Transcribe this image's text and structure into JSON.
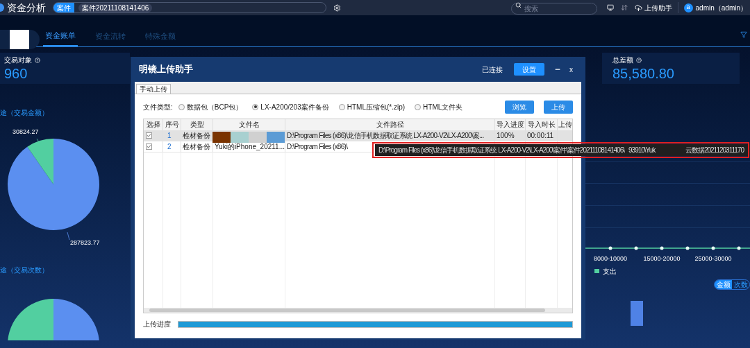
{
  "app": {
    "title": "资金分析",
    "case_tag": "案件",
    "case_chip": "案件20211108141406",
    "search": {
      "placeholder": "搜索"
    },
    "upload_helper": "上传助手",
    "avatar": "a",
    "user": "admin（admin）"
  },
  "tabs": [
    {
      "label": "资金账单",
      "selected": true
    },
    {
      "label": "资金流转",
      "selected": false
    },
    {
      "label": "特殊金额",
      "selected": false
    }
  ],
  "left": {
    "card": {
      "label": "交易对象",
      "value": "960"
    },
    "amount_title": "途（交易金额）",
    "chart_data": {
      "type": "pie",
      "values": [
        287823.77,
        30824.27
      ],
      "colors": [
        "#5b8ff0",
        "#52cfa0"
      ],
      "data_labels": true
    },
    "count_title": "途（交易次数）"
  },
  "right": {
    "card": {
      "label": "总差额",
      "value": "85,580.80"
    },
    "range_labels": [
      "8000-10000",
      "15000-20000",
      "25000-30000"
    ],
    "legend": {
      "label": "支出",
      "color": "#52cfa0"
    },
    "toggle": [
      {
        "label": "金额",
        "selected": true
      },
      {
        "label": "次数",
        "selected": false
      }
    ]
  },
  "dialog": {
    "title": "明镜上传助手",
    "status": "已连接",
    "settings": "设置",
    "close": "x",
    "tab": "手动上传",
    "file_type_label": "文件类型:",
    "file_types": [
      {
        "label": "数据包（BCP包）",
        "selected": false
      },
      {
        "label": "LX-A200/203案件备份",
        "selected": true
      },
      {
        "label": "HTML压缩包(*.zip)",
        "selected": false
      },
      {
        "label": "HTML文件夹",
        "selected": false
      }
    ],
    "browse": "浏览",
    "upload": "上传",
    "columns": [
      "选择",
      "序号",
      "类型",
      "文件名",
      "文件路径",
      "导入进度",
      "导入时长",
      "上传"
    ],
    "rows": [
      {
        "checked": true,
        "selected": true,
        "cells": [
          "",
          "1",
          "检材备份",
          "",
          "D:\\Program Files (x86)\\龙信手机数据取证系统 LX-A200-V2\\LX-A200\\案...",
          "100%",
          "00:00:11",
          ""
        ]
      },
      {
        "checked": true,
        "selected": false,
        "cells": [
          "",
          "2",
          "检材备份",
          "Yuki的iPhone_20211...",
          "D:\\Program Files (x86)\\",
          "",
          "",
          ""
        ]
      }
    ],
    "progress_label": "上传进度",
    "progress": {
      "level": 1
    }
  },
  "tooltip": {
    "parts": [
      "D:\\Program Files (x86)\\龙信手机数据取证系统 LX-A200-V2\\LX-A200\\案件\\案件20211108141406\\",
      "93910\\Yuk",
      "云数据2021120311170"
    ]
  }
}
